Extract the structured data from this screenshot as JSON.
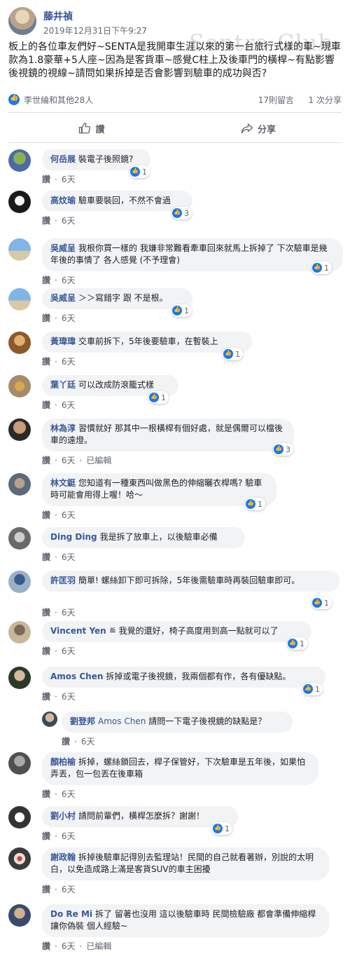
{
  "post": {
    "author": "藤井禎",
    "timestamp": "2019年12月31日下午9:27",
    "text": "板上的各位車友們好~SENTA是我開車生涯以來的第一台旅行式樣的車~現車款為1.8豪華+5人座~因為是客貨車~感覺C柱上及後車門的橫桿~有點影響後視鏡的視線~請問如果拆掉是否會影響到驗車的成功與否?",
    "watermark": "Sentra Club",
    "reactors": "李世綸和其他28人",
    "comments_count": "17則留言",
    "shares_count": "1 次分享"
  },
  "actions": {
    "like": "讚",
    "share": "分享"
  },
  "meta_labels": {
    "like": "讚",
    "dot": "·",
    "edited": "已編輯"
  },
  "colors": {
    "link": "#385898",
    "like_blue": "#1877f2",
    "bubble": "#f2f3f5",
    "meta": "#606770"
  },
  "comments": [
    {
      "name": "何岳展",
      "text": "裝電子後照鏡?",
      "time": "6天",
      "reactions": "1",
      "edited": false
    },
    {
      "name": "高炆瑜",
      "text": "驗車要裝回，不然不會過",
      "time": "6天",
      "reactions": "3",
      "edited": false
    },
    {
      "name": "吳威呈",
      "text": "我根你買一樣的 我嫌非常難看牽車回來就馬上拆掉了 下次驗車是幾年後的事情了 各人感覺 (不予理會)",
      "time": "6天",
      "reactions": "1",
      "edited": false
    },
    {
      "name": "吳威呈",
      "text": "＞＞寫錯字 跟 不是根。",
      "time": "6天",
      "reactions": "1",
      "edited": false
    },
    {
      "name": "黃瑋瑋",
      "text": "交車前拆下，5年後要驗車，在暫裝上",
      "time": "6天",
      "reactions": "1",
      "edited": false
    },
    {
      "name": "葉丫廷",
      "text": "可以改成防滾籠式樣",
      "time": "6天",
      "reactions": "1",
      "edited": false
    },
    {
      "name": "林為淳",
      "text": "習慣就好 那其中一根橫桿有個好處，就是偶爾可以檔後車的遠燈。",
      "time": "6天",
      "reactions": "3",
      "edited": true
    },
    {
      "name": "林文鋌",
      "text": "您知道有一種東西叫做黑色的伸縮曬衣桿嗎? 驗車時可能會用得上喔！哈～",
      "time": "6天",
      "reactions": "1",
      "edited": false
    },
    {
      "name": "Ding Ding",
      "text": "我是拆了放車上，以後驗車必備",
      "time": "6天",
      "reactions": "",
      "edited": false
    },
    {
      "name": "許匡羽",
      "text": "簡單! 螺絲卸下即可拆除，5年後需驗車時再裝回驗車即可。",
      "time": "6天",
      "reactions": "1",
      "edited": false
    },
    {
      "name": "Vincent Yen",
      "text": "≝ 我覺的還好，椅子高度用到高一點就可以了",
      "time": "6天",
      "reactions": "1",
      "edited": false
    },
    {
      "name": "Amos Chen",
      "text": "拆掉或電子後視鏡，我兩個都有作，各有優缺點。",
      "time": "6天",
      "reactions": "1",
      "edited": false
    },
    {
      "name": "顏柏榆",
      "text": "拆掉，螺絲鎖回去，桿子保管好，下次驗車是五年後，如果怕弄丟，包一包丟在後車箱",
      "time": "6天",
      "reactions": "",
      "edited": false
    },
    {
      "name": "劉小村",
      "text": "請問前輩們，橫桿怎麼拆？謝謝！",
      "time": "6天",
      "reactions": "1",
      "edited": false
    },
    {
      "name": "謝政翰",
      "text": "拆掉後驗車記得別去監理站！民間的自己就看著辦，別說的太明白，以免造成路上滿是客貨SUV的車主困擾",
      "time": "6天",
      "reactions": "",
      "edited": false
    },
    {
      "name": "Do Re Mi",
      "text": "拆了 留著也沒用 這以後驗車時 民間檢驗廠 都會準備伸縮桿 讓你偽裝 個人經驗~",
      "time": "6天",
      "reactions": "",
      "edited": true
    }
  ],
  "reply": {
    "name": "劉登邦",
    "mention": "Amos Chen",
    "text": "請問一下電子後視鏡的缺點是？",
    "time": "6天"
  }
}
